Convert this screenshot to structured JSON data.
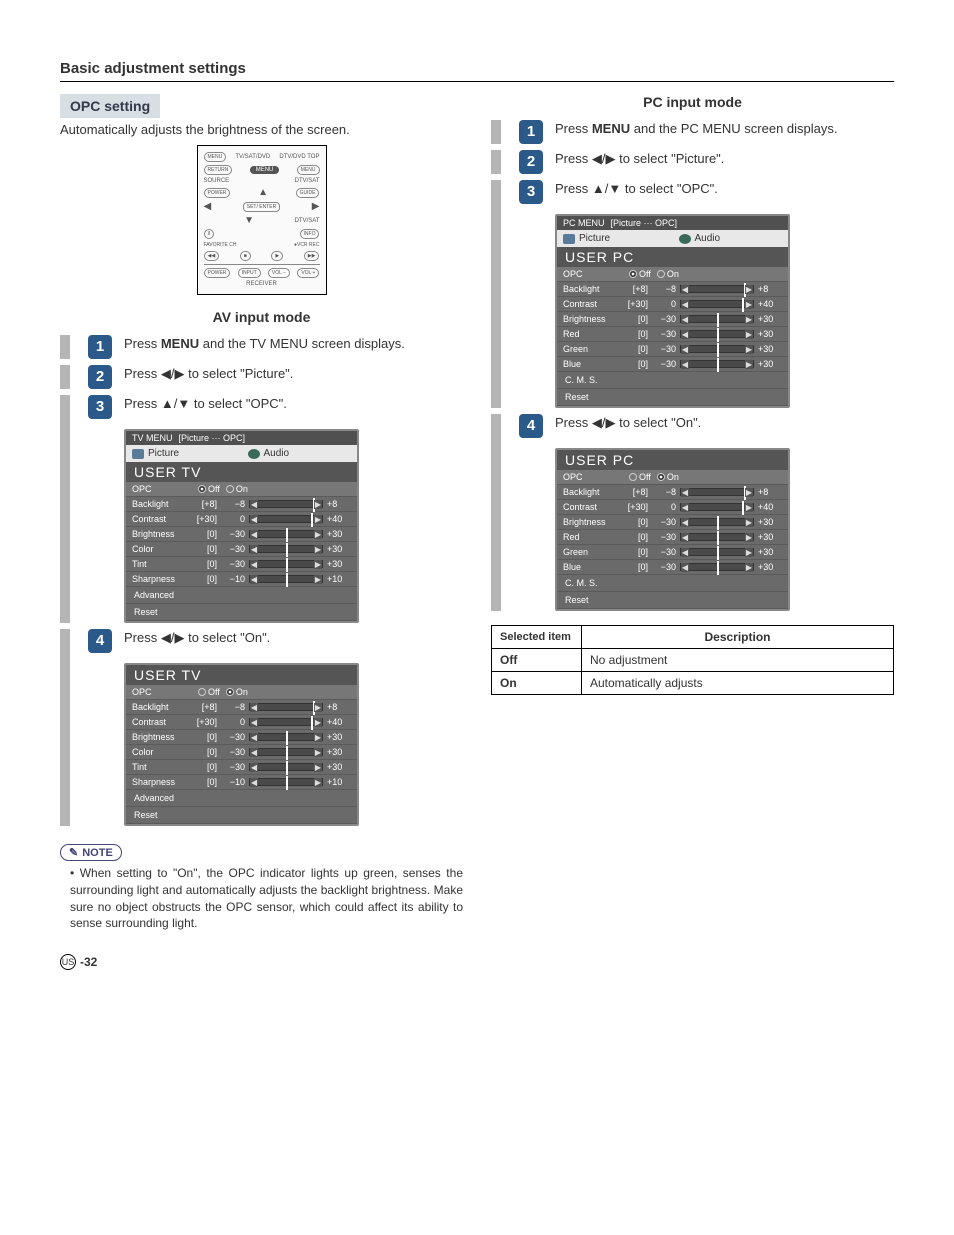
{
  "page_title": "Basic adjustment settings",
  "opc_setting_label": "OPC setting",
  "opc_setting_desc": "Automatically adjusts the brightness of the screen.",
  "av_mode_title": "AV input mode",
  "pc_mode_title": "PC input mode",
  "remote": {
    "tv_sat_dvd": "TV/SAT/DVD",
    "dtv_top": "DTV/DVD TOP",
    "menu_lbl_l": "MENU",
    "return": "RETURN",
    "menu_center": "MENU",
    "menu_lbl_r": "MENU",
    "source": "SOURCE",
    "dtv_sat": "DTV/SAT",
    "power": "POWER",
    "guide": "GUIDE",
    "set_enter": "SET/ ENTER",
    "info": "INFO",
    "favorite": "FAVORITE CH",
    "vcr": "VCR REC",
    "input": "INPUT",
    "vol_minus": "VOL −",
    "vol_plus": "VOL +",
    "receiver": "RECEIVER"
  },
  "av_steps": {
    "1": [
      "Press ",
      "MENU",
      " and the TV MENU screen displays."
    ],
    "2_pre": "Press ",
    "2_post": " to select \"Picture\".",
    "3_pre": "Press ",
    "3_post": " to select \"OPC\".",
    "4_pre": "Press ",
    "4_post": " to select \"On\"."
  },
  "pc_steps": {
    "1": [
      "Press ",
      "MENU",
      " and the PC MENU screen displays."
    ],
    "2_pre": "Press ",
    "2_post": " to select \"Picture\".",
    "3_pre": "Press ",
    "3_post": " to select \"OPC\".",
    "4_pre": "Press ",
    "4_post": " to select \"On\"."
  },
  "tv_menu": {
    "header": "TV MENU",
    "breadcrumb": "[Picture ··· OPC]",
    "tabs": {
      "picture": "Picture",
      "audio": "Audio"
    },
    "user_title": "USER TV",
    "opc_label": "OPC",
    "off": "Off",
    "on": "On",
    "rows": [
      {
        "label": "Backlight",
        "def": "[+8]",
        "min": "−8",
        "max": "+8",
        "pos": 87
      },
      {
        "label": "Contrast",
        "def": "[+30]",
        "min": "0",
        "max": "+40",
        "pos": 85
      },
      {
        "label": "Brightness",
        "def": "[0]",
        "min": "−30",
        "max": "+30",
        "pos": 50
      },
      {
        "label": "Color",
        "def": "[0]",
        "min": "−30",
        "max": "+30",
        "pos": 50
      },
      {
        "label": "Tint",
        "def": "[0]",
        "min": "−30",
        "max": "+30",
        "pos": 50
      },
      {
        "label": "Sharpness",
        "def": "[0]",
        "min": "−10",
        "max": "+10",
        "pos": 50
      }
    ],
    "plain": [
      "Advanced",
      "Reset"
    ]
  },
  "pc_menu": {
    "header": "PC MENU",
    "breadcrumb": "[Picture ··· OPC]",
    "user_title": "USER PC",
    "rows": [
      {
        "label": "Backlight",
        "def": "[+8]",
        "min": "−8",
        "max": "+8",
        "pos": 87
      },
      {
        "label": "Contrast",
        "def": "[+30]",
        "min": "0",
        "max": "+40",
        "pos": 85
      },
      {
        "label": "Brightness",
        "def": "[0]",
        "min": "−30",
        "max": "+30",
        "pos": 50
      },
      {
        "label": "Red",
        "def": "[0]",
        "min": "−30",
        "max": "+30",
        "pos": 50
      },
      {
        "label": "Green",
        "def": "[0]",
        "min": "−30",
        "max": "+30",
        "pos": 50
      },
      {
        "label": "Blue",
        "def": "[0]",
        "min": "−30",
        "max": "+30",
        "pos": 50
      }
    ],
    "plain": [
      "C. M. S.",
      "Reset"
    ]
  },
  "note_label": "NOTE",
  "note_text": "When setting to \"On\", the OPC indicator lights up green, senses the surrounding light and automatically adjusts the backlight brightness. Make sure no object obstructs the OPC sensor, which could affect its ability to sense surrounding light.",
  "table": {
    "h1": "Selected item",
    "h2": "Description",
    "r1a": "Off",
    "r1b": "No adjustment",
    "r2a": "On",
    "r2b": "Automatically adjusts"
  },
  "page_region": "US",
  "page_number": "-32"
}
